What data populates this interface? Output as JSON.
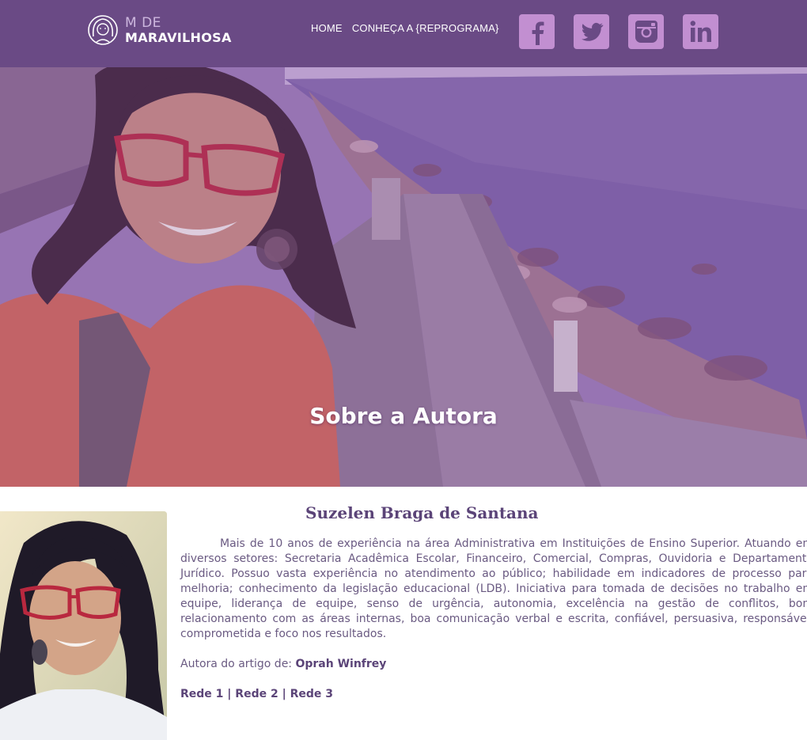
{
  "brand": {
    "line1": "M DE",
    "line2": "MARAVILHOSA",
    "color_header": "#6a4a85",
    "color_social": "#c28fd1"
  },
  "nav": {
    "items": [
      {
        "label": "HOME"
      },
      {
        "label": "CONHEÇA A {REPROGRAMA}"
      }
    ]
  },
  "socials": [
    {
      "icon": "facebook-icon"
    },
    {
      "icon": "twitter-icon"
    },
    {
      "icon": "instagram-icon"
    },
    {
      "icon": "linkedin-icon"
    }
  ],
  "hero": {
    "title": "Sobre a Autora"
  },
  "author": {
    "name": "Suzelen Braga de Santana",
    "bio": "Mais de 10 anos de experiência na área Administrativa em Instituições de Ensino Superior. Atuando em diversos setores: Secretaria Acadêmica Escolar, Financeiro, Comercial, Compras, Ouvidoria e Departamento Jurídico. Possuo vasta experiência no atendimento ao público; habilidade em indicadores de processo para melhoria; conhecimento da legislação educacional (LDB). Iniciativa para tomada de decisões no trabalho em equipe, liderança de equipe, senso de urgência, autonomia, excelência na gestão de conflitos, bom relacionamento com as áreas internas, boa comunicação verbal e escrita, confiável, persuasiva, responsável, comprometida e foco nos resultados.",
    "credit_label": "Autora do artigo de:",
    "credit_name": "Oprah Winfrey",
    "links": [
      "Rede 1",
      "Rede 2",
      "Rede 3"
    ],
    "separator": "|"
  }
}
